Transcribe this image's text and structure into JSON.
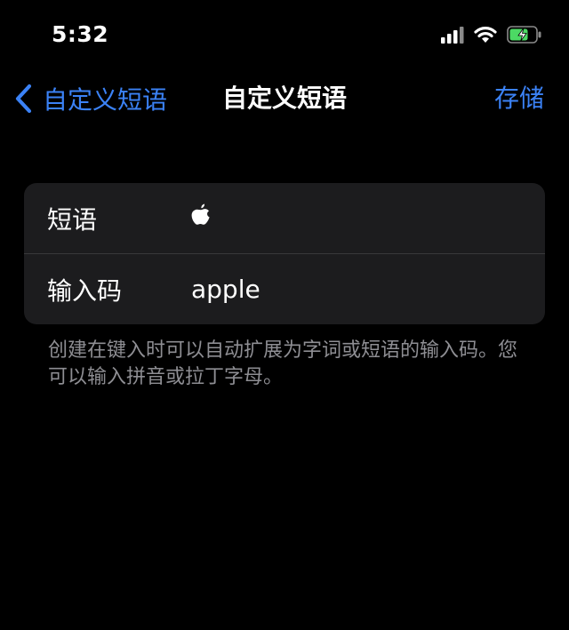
{
  "status_bar": {
    "time": "5:32",
    "icons": [
      "cellular-signal-icon",
      "wifi-icon",
      "battery-charging-icon"
    ],
    "battery_color": "#4cd964"
  },
  "nav": {
    "back_label": "自定义短语",
    "title": "自定义短语",
    "save_label": "存储"
  },
  "form": {
    "phrase_label": "短语",
    "phrase_value_icon": "apple-logo-icon",
    "shortcut_label": "输入码",
    "shortcut_value": "apple"
  },
  "footnote": "创建在键入时可以自动扩展为字词或短语的输入码。您可以输入拼音或拉丁字母。",
  "colors": {
    "accent": "#3b82f6",
    "background": "#000000",
    "group_background": "#1c1c1e",
    "secondary_text": "#8e8e93"
  }
}
